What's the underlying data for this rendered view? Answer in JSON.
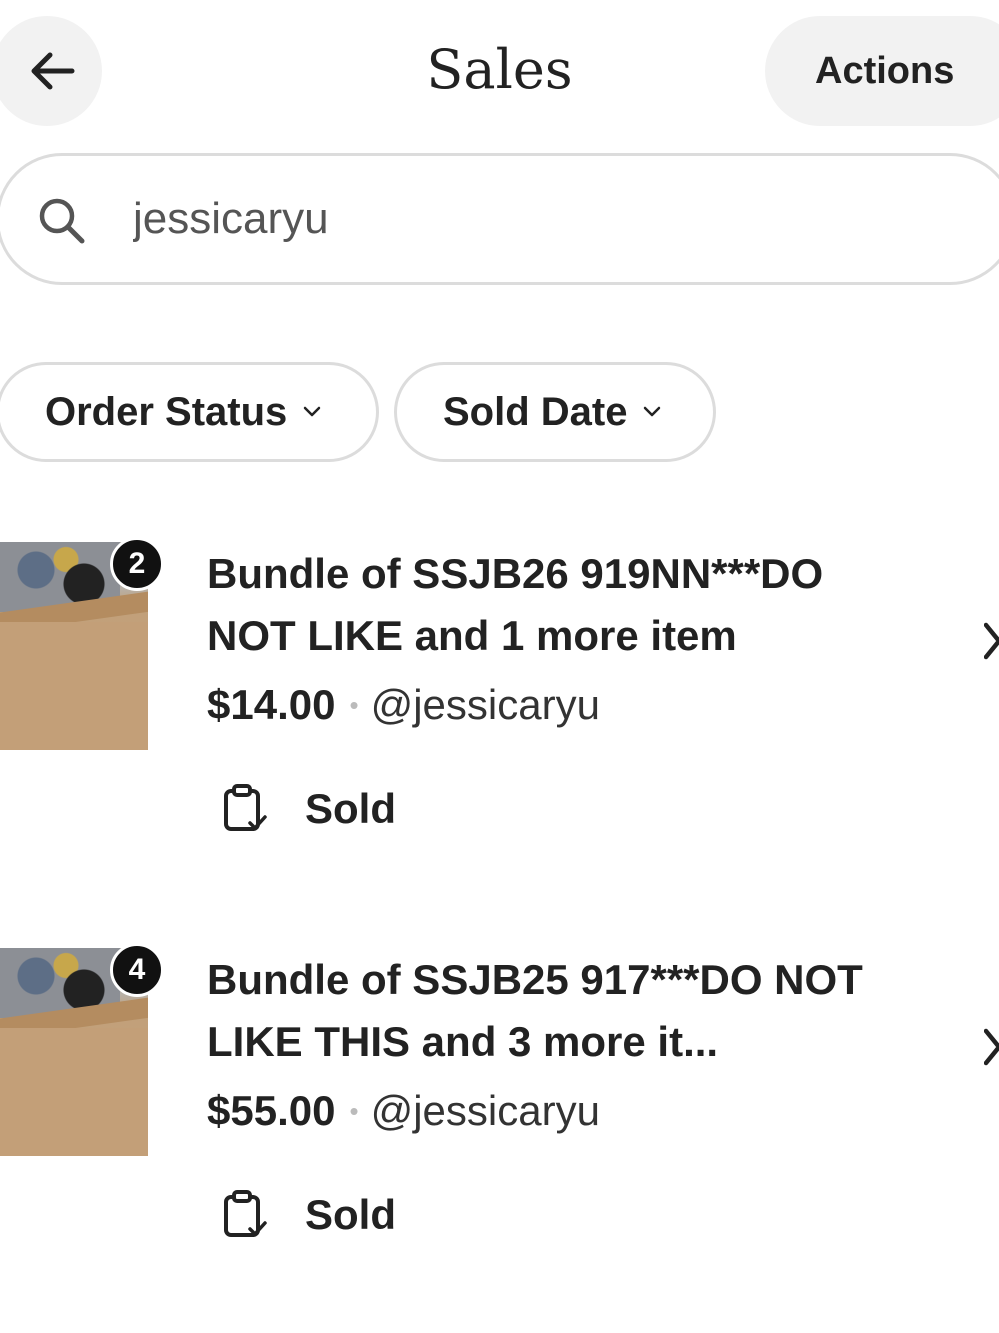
{
  "header": {
    "title": "Sales",
    "actions_label": "Actions",
    "back_icon": "arrow-left-icon"
  },
  "search": {
    "value": "jessicaryu",
    "icon": "search-icon"
  },
  "filters": [
    {
      "label": "Order Status",
      "icon": "chevron-down-icon"
    },
    {
      "label": "Sold Date",
      "icon": "chevron-down-icon"
    }
  ],
  "orders": [
    {
      "badge": "2",
      "title": "Bundle of SSJB26 919NN***DO NOT LIKE and 1 more item",
      "price": "$14.00",
      "separator": "•",
      "buyer": "@jessicaryu",
      "status": "Sold",
      "status_icon": "clipboard-check-icon"
    },
    {
      "badge": "4",
      "title": "Bundle of SSJB25 917***DO NOT LIKE THIS and 3 more it...",
      "price": "$55.00",
      "separator": "•",
      "buyer": "@jessicaryu",
      "status": "Sold",
      "status_icon": "clipboard-check-icon"
    }
  ],
  "colors": {
    "text": "#222222",
    "pill_background": "#f2f2f2",
    "border": "#dcdcdc"
  }
}
